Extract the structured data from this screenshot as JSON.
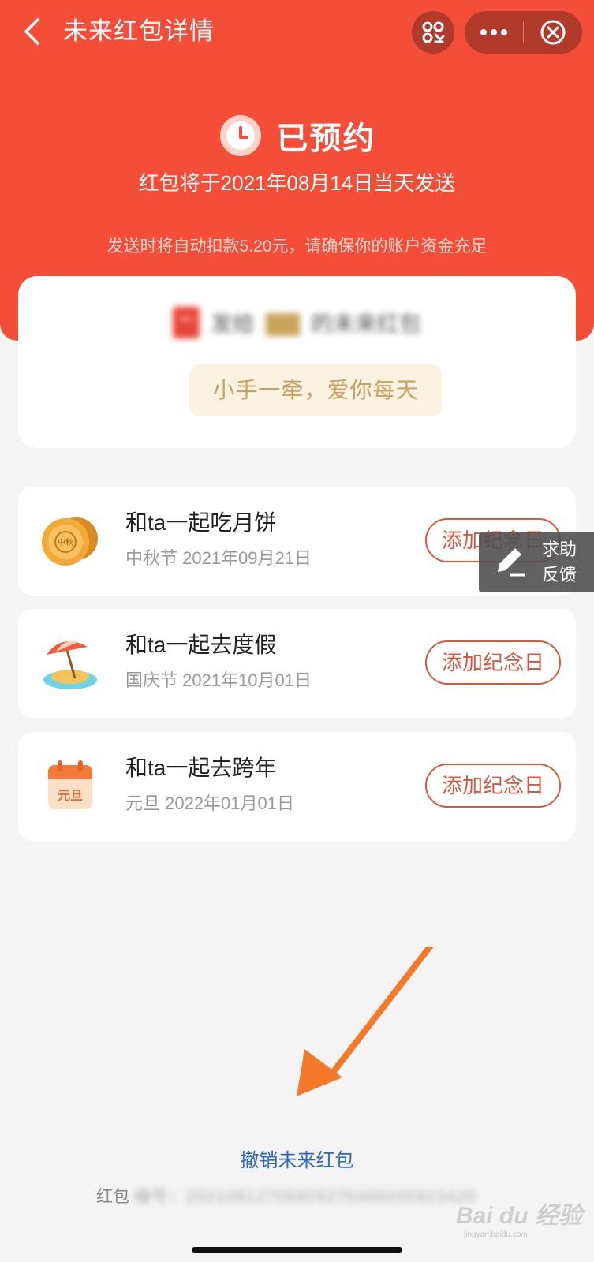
{
  "colors": {
    "brand": "#f54e38",
    "accent_button": "#d9573f",
    "link": "#2f67c8",
    "blessing_text": "#c8a163"
  },
  "nav": {
    "title": "未来红包详情",
    "back_icon": "chevron-left-icon",
    "scan_icon": "scan-icon",
    "more_icon": "more-dots-icon",
    "close_icon": "close-circle-icon"
  },
  "status": {
    "icon": "clock-icon",
    "label": "已预约",
    "send_date": "红包将于2021年08月14日当天发送",
    "deduct_note": "发送时将自动扣款5.20元，请确保你的账户资金充足"
  },
  "message_card": {
    "line_prefix": "发给",
    "recipient": "▇▇",
    "line_suffix": "的未来红包",
    "blessing": "小手一牵，爱你每天"
  },
  "events": [
    {
      "title": "和ta一起吃月饼",
      "subtitle": "中秋节 2021年09月21日",
      "button": "添加纪念日",
      "icon": "mooncake-icon"
    },
    {
      "title": "和ta一起去度假",
      "subtitle": "国庆节 2021年10月01日",
      "button": "添加纪念日",
      "icon": "beach-umbrella-icon"
    },
    {
      "title": "和ta一起去跨年",
      "subtitle": "元旦 2022年01月01日",
      "button": "添加纪念日",
      "icon": "calendar-newyear-icon"
    }
  ],
  "calendar_icon_text": "元旦",
  "mooncake_text": "中秋",
  "help": {
    "line1": "求助",
    "line2": "反馈"
  },
  "footer": {
    "cancel_link": "撤销未来红包",
    "packet_id_label": "红包",
    "packet_id_value": "编号：20210812706809270466035923420"
  },
  "watermark": {
    "text": "Bai du 经验",
    "url": "jingyan.baidu.com"
  }
}
